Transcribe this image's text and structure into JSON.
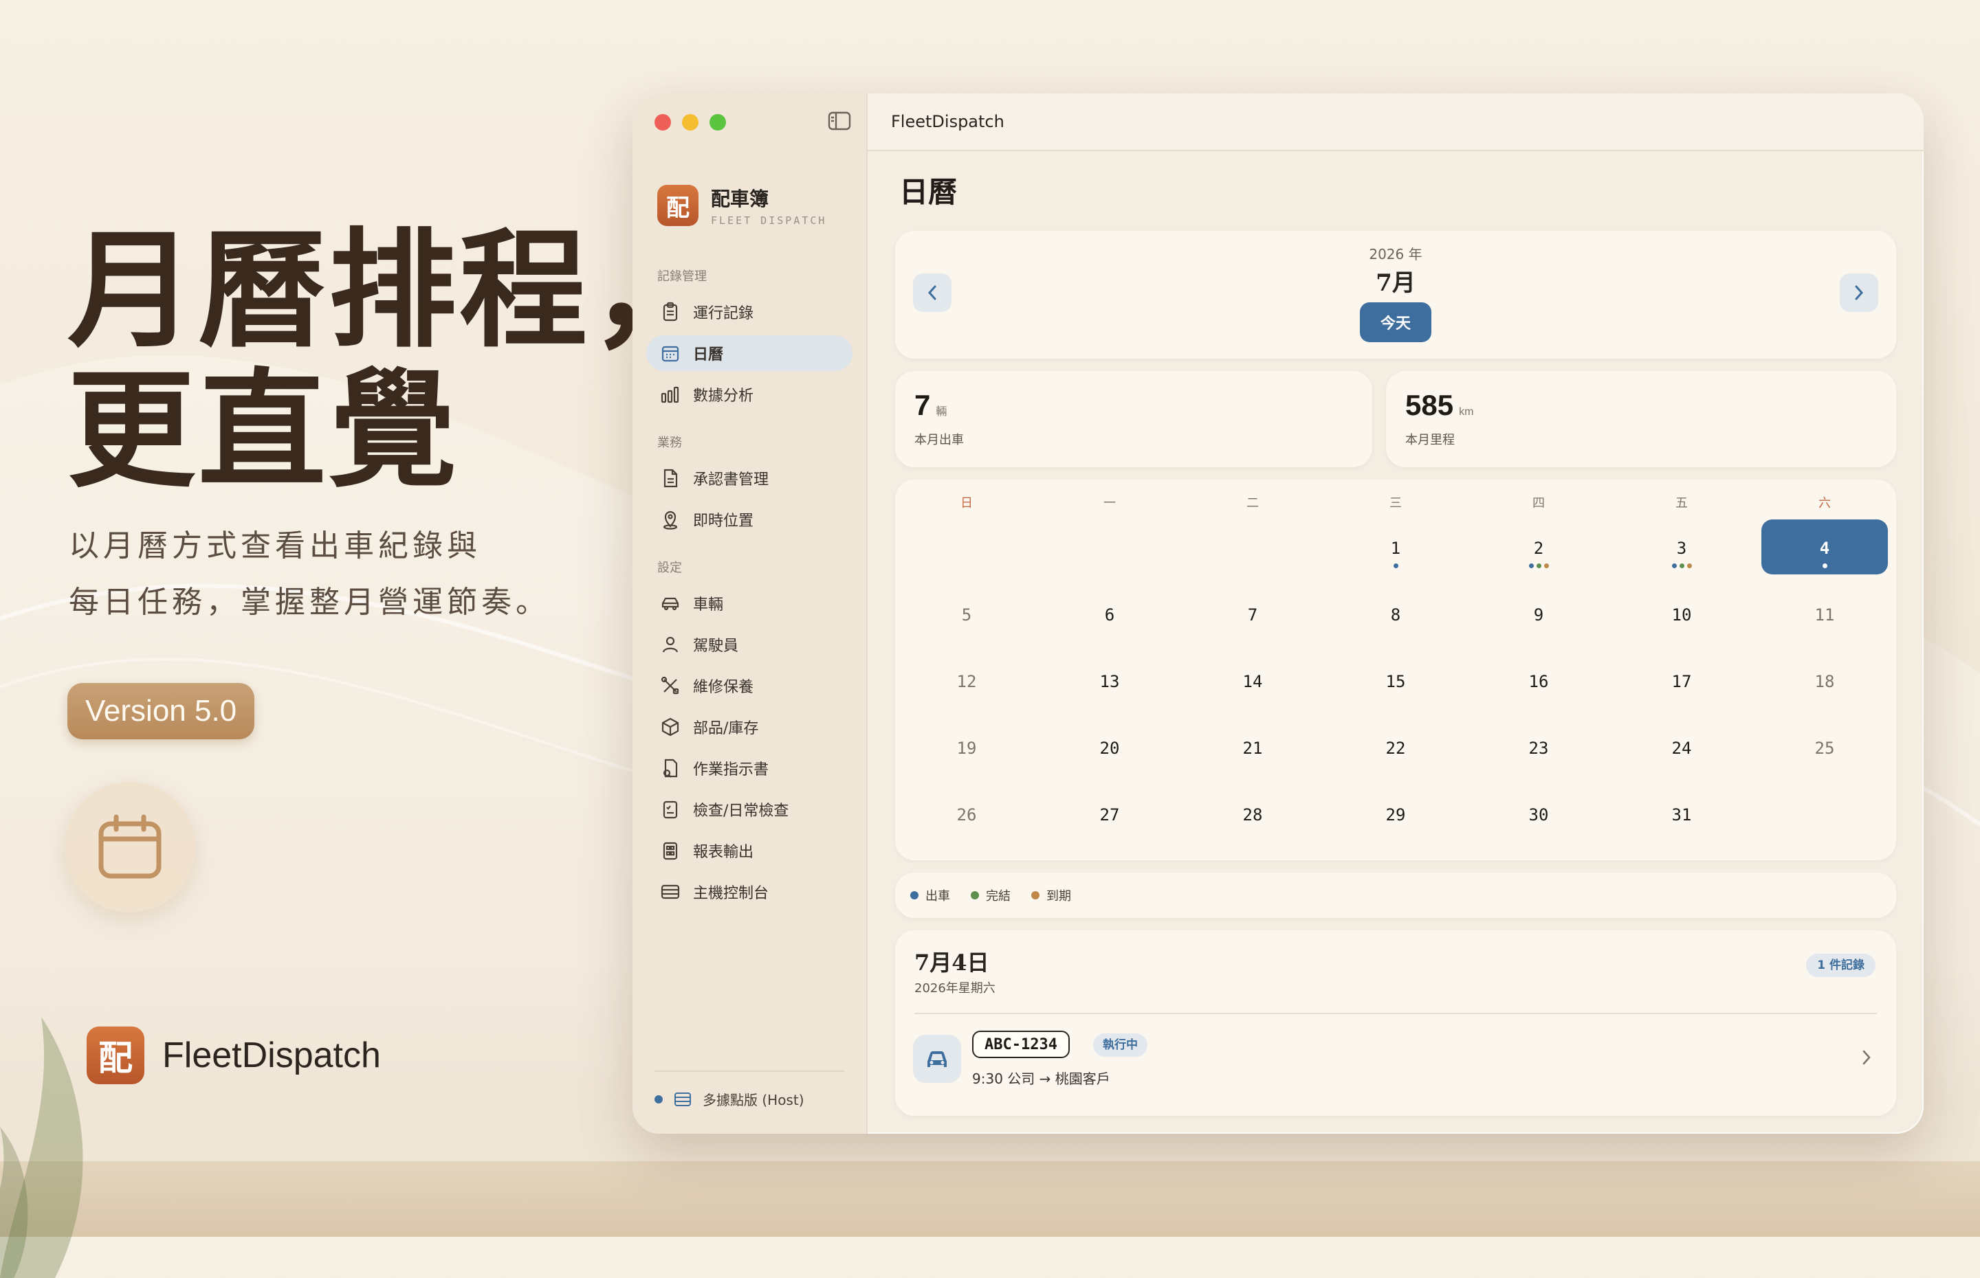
{
  "hero": {
    "title_line1": "月曆排程，",
    "title_line2": "更直覺",
    "subtitle_line1": "以月曆方式查看出車紀錄與",
    "subtitle_line2": "每日任務，掌握整月營運節奏。",
    "version": "Version 5.0",
    "brand_logo": "配",
    "brand_name": "FleetDispatch"
  },
  "window": {
    "title": "FleetDispatch",
    "app_logo": "配",
    "app_name": "配車簿",
    "app_subtitle": "FLEET DISPATCH"
  },
  "sidebar": {
    "sections": [
      {
        "label": "記錄管理",
        "items": [
          {
            "label": "運行記錄",
            "icon": "clipboard-icon"
          },
          {
            "label": "日曆",
            "icon": "calendar-icon",
            "active": true
          },
          {
            "label": "數據分析",
            "icon": "bar-chart-icon"
          }
        ]
      },
      {
        "label": "業務",
        "items": [
          {
            "label": "承認書管理",
            "icon": "document-icon"
          },
          {
            "label": "即時位置",
            "icon": "location-icon"
          }
        ]
      },
      {
        "label": "設定",
        "items": [
          {
            "label": "車輛",
            "icon": "car-icon"
          },
          {
            "label": "駕駛員",
            "icon": "person-icon"
          },
          {
            "label": "維修保養",
            "icon": "tools-icon"
          },
          {
            "label": "部品/庫存",
            "icon": "box-icon"
          },
          {
            "label": "作業指示書",
            "icon": "instruction-icon"
          },
          {
            "label": "檢查/日常檢查",
            "icon": "checklist-icon"
          },
          {
            "label": "報表輸出",
            "icon": "report-icon"
          },
          {
            "label": "主機控制台",
            "icon": "server-icon"
          }
        ]
      }
    ],
    "host_status": "多據點版 (Host)"
  },
  "main": {
    "page_title": "日曆",
    "year_label": "2026 年",
    "month_label": "7月",
    "today_button": "今天",
    "stats": [
      {
        "value": "7",
        "unit": "輛",
        "label": "本月出車"
      },
      {
        "value": "585",
        "unit": "km",
        "label": "本月里程"
      }
    ],
    "weekdays": [
      "日",
      "一",
      "二",
      "三",
      "四",
      "五",
      "六"
    ],
    "leading_blanks": 3,
    "days_in_month": 31,
    "selected_day": 4,
    "day_dots": {
      "1": [
        "#3e6e9d"
      ],
      "2": [
        "#3e6e9d",
        "#5e8f4e",
        "#c0874a"
      ],
      "3": [
        "#3e6e9d",
        "#5e8f4e",
        "#c0874a"
      ],
      "4": [
        "#ffffff"
      ]
    },
    "legend": [
      {
        "label": "出車",
        "color": "#3e6e9d"
      },
      {
        "label": "完結",
        "color": "#5e8f4e"
      },
      {
        "label": "到期",
        "color": "#c0874a"
      }
    ],
    "detail": {
      "date": "7月4日",
      "weekday": "2026年星期六",
      "record_count": "1 件記錄",
      "trip": {
        "plate": "ABC-1234",
        "status": "執行中",
        "info": "9:30  公司 → 桃園客戶"
      }
    }
  },
  "colors": {
    "accent": "#3e6e9d",
    "brand": "#c6652f"
  }
}
